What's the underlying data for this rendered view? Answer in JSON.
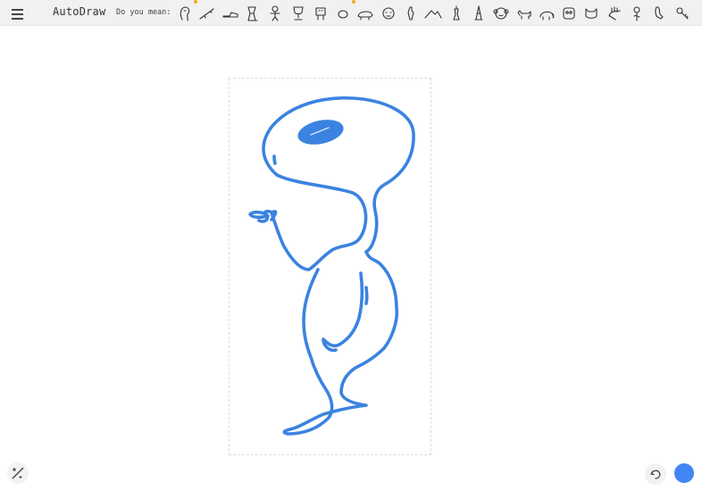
{
  "app": {
    "title": "AutoDraw"
  },
  "suggestions": {
    "label": "Do you mean:",
    "items": [
      {
        "icon": "alien-icon",
        "starred": true
      },
      {
        "icon": "rifle-icon",
        "starred": false
      },
      {
        "icon": "shoe-icon",
        "starred": false
      },
      {
        "icon": "chair-icon",
        "starred": false
      },
      {
        "icon": "gingerbread-man-icon",
        "starred": false
      },
      {
        "icon": "trophy-icon",
        "starred": false
      },
      {
        "icon": "robot-icon",
        "starred": false
      },
      {
        "icon": "lemon-icon",
        "starred": true
      },
      {
        "icon": "bear-icon",
        "starred": false
      },
      {
        "icon": "tiger-face-icon",
        "starred": false
      },
      {
        "icon": "figure-icon",
        "starred": false
      },
      {
        "icon": "mountain-icon",
        "starred": false
      },
      {
        "icon": "chess-piece-icon",
        "starred": false
      },
      {
        "icon": "tower-icon",
        "starred": false
      },
      {
        "icon": "monkey-face-icon",
        "starred": false
      },
      {
        "icon": "dog-icon",
        "starred": false
      },
      {
        "icon": "elephant-icon",
        "starred": false
      },
      {
        "icon": "panda-icon",
        "starred": false
      },
      {
        "icon": "cat-face-icon",
        "starred": false
      },
      {
        "icon": "hand-icon",
        "starred": false
      },
      {
        "icon": "flower-icon",
        "starred": false
      },
      {
        "icon": "foot-icon",
        "starred": false
      },
      {
        "icon": "key-icon",
        "starred": false
      }
    ]
  },
  "colors": {
    "stroke": "#3b83e0",
    "accent": "#4285f4",
    "star": "#f5a623"
  },
  "tools": {
    "current_tool_icon": "autodraw-tool-icon",
    "undo_icon": "undo-icon",
    "color_icon": "color-picker-icon"
  }
}
